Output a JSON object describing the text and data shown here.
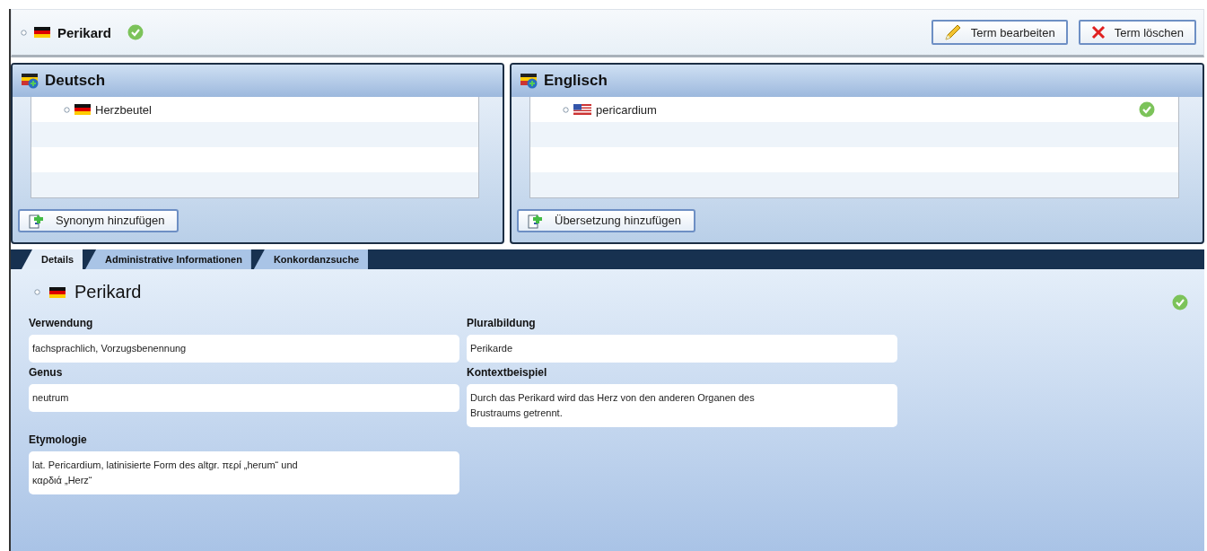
{
  "term": {
    "kind": "de",
    "text": "Perikard",
    "approved": true
  },
  "actions": [
    {
      "kind": "edit",
      "label": "Term bearbeiten"
    },
    {
      "kind": "delete",
      "label": "Term löschen"
    }
  ],
  "panels": [
    {
      "title": "Deutsch",
      "terms": [
        {
          "kind": "de",
          "text": "Herzbeutel",
          "approved": false
        }
      ],
      "button": "Synonym hinzufügen"
    },
    {
      "title": "Englisch",
      "terms": [
        {
          "kind": "us",
          "text": "pericardium",
          "approved": true
        }
      ],
      "button": "Übersetzung hinzufügen"
    }
  ],
  "tabs": [
    {
      "label": "Details",
      "selected": true
    },
    {
      "label": "Administrative Informationen",
      "selected": false
    },
    {
      "label": "Konkordanzsuche",
      "selected": false
    }
  ],
  "details": {
    "kind": "de",
    "title": "Perikard",
    "approved": true,
    "columns": [
      {
        "fields": [
          {
            "label": "Verwendung",
            "value": "fachsprachlich, Vorzugsbenennung"
          },
          {
            "label": "Genus",
            "value": "neutrum"
          },
          {
            "label": "Etymologie",
            "value": "lat. Pericardium, latinisierte Form des altgr. περί „herum“ und\nκαρδιά „Herz“"
          }
        ]
      },
      {
        "fields": [
          {
            "label": "Pluralbildung",
            "value": "Perikarde"
          },
          {
            "label": "Kontextbeispiel",
            "value": "Durch das Perikard wird das Herz von den anderen Organen des\nBrustraums getrennt."
          }
        ]
      }
    ]
  }
}
